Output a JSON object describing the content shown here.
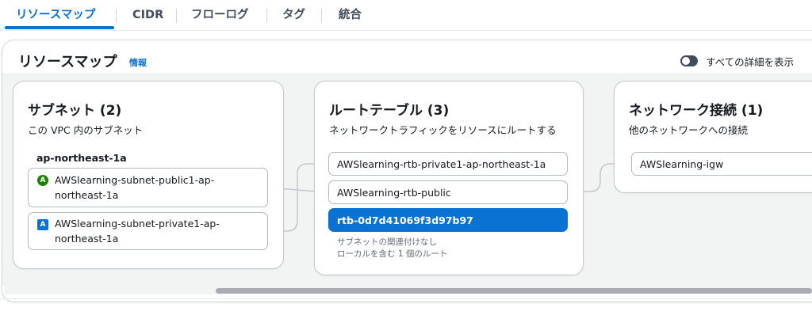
{
  "tabs": [
    {
      "label": "リソースマップ",
      "active": true
    },
    {
      "label": "CIDR"
    },
    {
      "label": "フローログ"
    },
    {
      "label": "タグ"
    },
    {
      "label": "統合"
    }
  ],
  "panel": {
    "title": "リソースマップ",
    "info_link": "情報",
    "toggle_label": "すべての詳細を表示"
  },
  "subnets": {
    "title": "サブネット (2)",
    "description": "この VPC 内のサブネット",
    "az": "ap-northeast-1a",
    "items": [
      {
        "badge": "A",
        "line1": "AWSlearning-subnet-public1-ap-",
        "line2": "northeast-1a",
        "badge_color": "#1d8102"
      },
      {
        "badge": "A",
        "line1": "AWSlearning-subnet-private1-ap-",
        "line2": "northeast-1a",
        "badge_color": "#0972d3"
      }
    ]
  },
  "route_tables": {
    "title": "ルートテーブル (3)",
    "description": "ネットワークトラフィックをリソースにルートする",
    "items": [
      {
        "label": "AWSlearning-rtb-private1-ap-northeast-1a"
      },
      {
        "label": "AWSlearning-rtb-public"
      },
      {
        "label": "rtb-0d7d41069f3d97b97",
        "selected": true
      }
    ],
    "notes": [
      "サブネットの関連付けなし",
      "ローカルを含む 1 個のルート"
    ]
  },
  "network": {
    "title": "ネットワーク接続 (1)",
    "description": "他のネットワークへの接続",
    "items": [
      {
        "label": "AWSlearning-igw"
      }
    ]
  },
  "colors": {
    "accent": "#0972d3",
    "public_badge": "#1d8102",
    "connector": "#c6c6cd"
  }
}
